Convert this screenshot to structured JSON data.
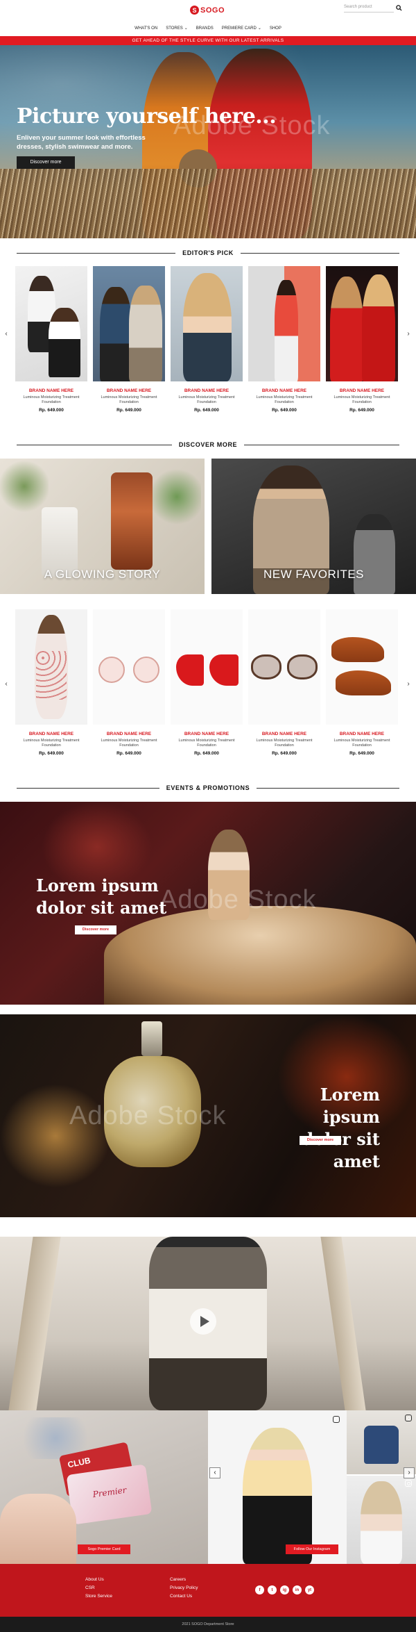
{
  "header": {
    "logo_text": "SOGO",
    "search_placeholder": "Search product",
    "nav": [
      {
        "label": "WHAT'S ON"
      },
      {
        "label": "STORES"
      },
      {
        "label": "BRANDS"
      },
      {
        "label": "PREMIERE CARD"
      },
      {
        "label": "SHOP"
      }
    ],
    "promo": "GET AHEAD OF THE STYLE CURVE WITH OUR LATEST ARRIVALS"
  },
  "hero": {
    "title": "Picture yourself here...",
    "subtitle": "Enliven your summer look with effortless dresses, stylish swimwear and more.",
    "button": "Discover more",
    "watermark": "Adobe Stock"
  },
  "editors_pick": {
    "title": "EDITOR'S PICK",
    "products": [
      {
        "brand": "BRAND NAME HERE",
        "desc": "Luminous Moisturizing Treatment Foundation",
        "price": "Rp. 649.000"
      },
      {
        "brand": "BRAND NAME HERE",
        "desc": "Luminous Moisturizing Treatment Foundation",
        "price": "Rp. 649.000"
      },
      {
        "brand": "BRAND NAME HERE",
        "desc": "Luminous Moisturizing Treatment Foundation",
        "price": "Rp. 649.000"
      },
      {
        "brand": "BRAND NAME HERE",
        "desc": "Luminous Moisturizing Treatment Foundation",
        "price": "Rp. 649.000"
      },
      {
        "brand": "BRAND NAME HERE",
        "desc": "Luminous Moisturizing Treatment Foundation",
        "price": "Rp. 649.000"
      }
    ]
  },
  "discover_more": {
    "title": "DISCOVER MORE",
    "left_label": "A GLOWING STORY",
    "right_label": "NEW FAVORITES"
  },
  "discover_products": [
    {
      "brand": "BRAND NAME HERE",
      "desc": "Luminous Moisturizing Treatment Foundation",
      "price": "Rp. 649.000"
    },
    {
      "brand": "BRAND NAME HERE",
      "desc": "Luminous Moisturizing Treatment Foundation",
      "price": "Rp. 649.000"
    },
    {
      "brand": "BRAND NAME HERE",
      "desc": "Luminous Moisturizing Treatment Foundation",
      "price": "Rp. 649.000"
    },
    {
      "brand": "BRAND NAME HERE",
      "desc": "Luminous Moisturizing Treatment Foundation",
      "price": "Rp. 649.000"
    },
    {
      "brand": "BRAND NAME HERE",
      "desc": "Luminous Moisturizing Treatment Foundation",
      "price": "Rp. 649.000"
    }
  ],
  "events": {
    "title": "EVENTS & PROMOTIONS",
    "banner1": {
      "line1": "Lorem ipsum",
      "line2": "dolor sit amet",
      "button": "Discover more"
    },
    "banner2": {
      "line1": "Lorem ipsum",
      "line2": "dolor sit amet",
      "button": "Discover more"
    },
    "watermark": "Adobe Stock"
  },
  "card_section": {
    "card_label": "Premier",
    "club_label": "CLUB",
    "button": "Sogo Premier Card"
  },
  "instagram": {
    "button": "Follow Our Instagram"
  },
  "footer": {
    "col1": [
      "About Us",
      "CSR",
      "Store Service"
    ],
    "col2": [
      "Careers",
      "Privacy Policy",
      "Contact Us"
    ],
    "social": [
      "f",
      "t",
      "ig",
      "in",
      "yt"
    ],
    "copyright": "2021 SOGO Department Store"
  },
  "colors": {
    "brand_red": "#e11b22",
    "footer_red": "#c0161c"
  }
}
